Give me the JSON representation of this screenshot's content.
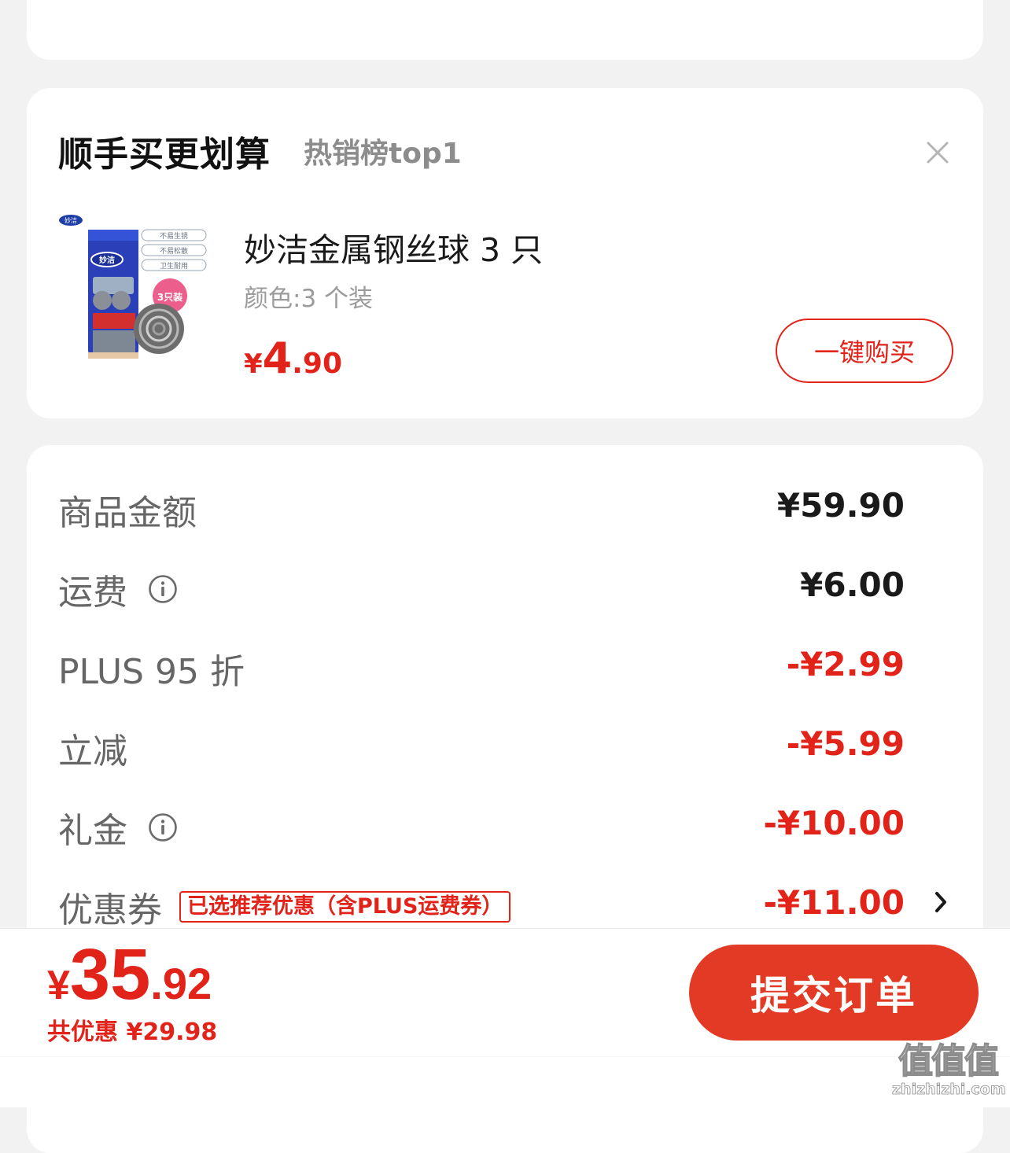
{
  "addon": {
    "title": "顺手买更划算",
    "subtitle": "热销榜top1",
    "product": {
      "name": "妙洁金属钢丝球 3 只",
      "variant": "颜色:3 个装",
      "price_currency": "¥",
      "price_int": "4",
      "price_dec": ".90",
      "image_brand": "妙洁",
      "image_tags": [
        "不易生锈",
        "不易松散",
        "卫生耐用"
      ],
      "image_badge": "3只装"
    },
    "buy_now_label": "一键购买"
  },
  "summary": {
    "rows": [
      {
        "label": "商品金额",
        "value": "¥59.90"
      },
      {
        "label": "运费",
        "value": "¥6.00"
      },
      {
        "label": "PLUS 95 折",
        "value": "-¥2.99"
      },
      {
        "label": "立减",
        "value": "-¥5.99"
      },
      {
        "label": "礼金",
        "value": "-¥10.00"
      },
      {
        "label": "优惠券",
        "value": "-¥11.00"
      }
    ],
    "coupon_tag": "已选推荐优惠（含PLUS运费券）"
  },
  "footer": {
    "total_currency": "¥",
    "total_int": "35",
    "total_dec": ".92",
    "savings": "共优惠 ¥29.98",
    "submit_label": "提交订单"
  },
  "watermark": {
    "glyphs": "值值值",
    "domain": "zhizhizhi.com"
  },
  "colors": {
    "accent": "#e2231a",
    "submit_bg": "#e33a26",
    "page_bg": "#f2f2f2",
    "label_gray": "#666666"
  }
}
